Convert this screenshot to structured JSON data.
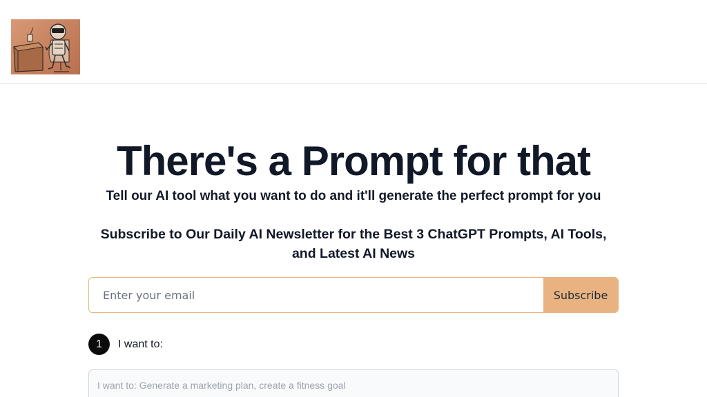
{
  "header": {
    "logo_icon": "robot-at-desk-icon"
  },
  "hero": {
    "title": "There's a Prompt for that",
    "subtitle": "Tell our AI tool what you want to do and it'll generate the perfect prompt for you"
  },
  "newsletter": {
    "heading": "Subscribe to Our Daily AI Newsletter for the Best 3 ChatGPT Prompts, AI Tools, and Latest AI News",
    "email_placeholder": "Enter your email",
    "subscribe_label": "Subscribe"
  },
  "step": {
    "number": "1",
    "label": "I want to:",
    "input_placeholder": "I want to: Generate a marketing plan, create a fitness goal"
  },
  "colors": {
    "accent": "#e9b381",
    "title": "#111827",
    "badge": "#0b0b0b"
  }
}
